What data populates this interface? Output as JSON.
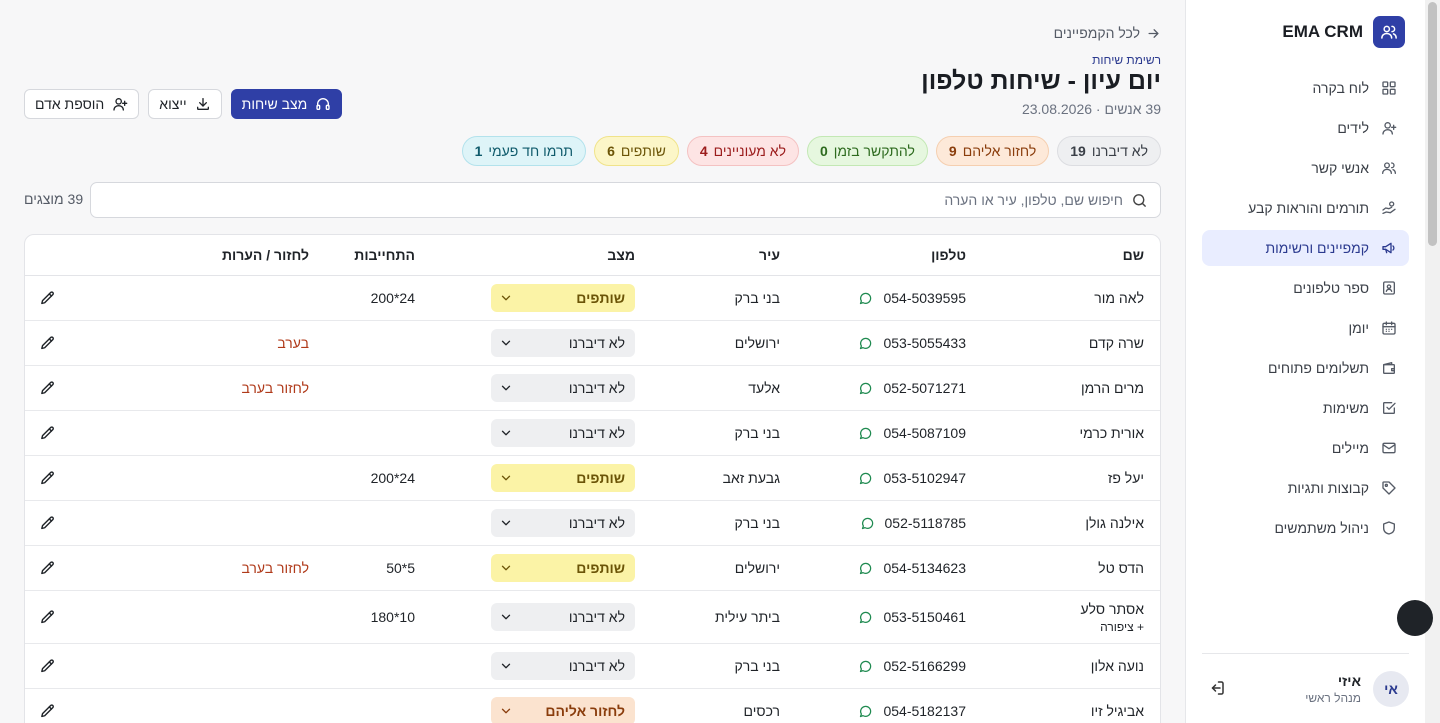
{
  "brand": {
    "name": "EMA CRM"
  },
  "nav": [
    {
      "id": "dashboard",
      "label": "לוח בקרה",
      "icon": "dashboard-icon"
    },
    {
      "id": "leads",
      "label": "לידים",
      "icon": "user-plus-icon"
    },
    {
      "id": "contacts",
      "label": "אנשי קשר",
      "icon": "users-icon"
    },
    {
      "id": "donors",
      "label": "תורמים והוראות קבע",
      "icon": "hand-coins-icon"
    },
    {
      "id": "campaigns",
      "label": "קמפיינים ורשימות",
      "icon": "megaphone-icon",
      "active": true
    },
    {
      "id": "phonebook",
      "label": "ספר טלפונים",
      "icon": "contact-book-icon"
    },
    {
      "id": "calendar",
      "label": "יומן",
      "icon": "calendar-icon"
    },
    {
      "id": "payments",
      "label": "תשלומים פתוחים",
      "icon": "wallet-icon"
    },
    {
      "id": "tasks",
      "label": "משימות",
      "icon": "checkbox-icon"
    },
    {
      "id": "emails",
      "label": "מיילים",
      "icon": "mail-icon"
    },
    {
      "id": "groups",
      "label": "קבוצות ותגיות",
      "icon": "tag-icon"
    },
    {
      "id": "users",
      "label": "ניהול משתמשים",
      "icon": "shield-icon"
    }
  ],
  "user": {
    "initials": "אי",
    "name": "איזי",
    "role": "מנהל ראשי"
  },
  "header": {
    "back": "לכל הקמפיינים",
    "section": "רשימת שיחות",
    "title": "יום עיון - שיחות טלפון",
    "subtitle": "39 אנשים · 23.08.2026"
  },
  "actions": {
    "call_mode": "מצב שיחות",
    "export": "ייצוא",
    "add_person": "הוספת אדם"
  },
  "chips": [
    {
      "label": "לא דיברנו",
      "count": "19",
      "bg": "#eeeff1",
      "border": "#dcdde1",
      "color": "#3a3f47"
    },
    {
      "label": "לחזור אליהם",
      "count": "9",
      "bg": "#fde9d9",
      "border": "#f5cfb0",
      "color": "#8a3d0c"
    },
    {
      "label": "להתקשר בזמן",
      "count": "0",
      "bg": "#e6f7df",
      "border": "#c3e8b4",
      "color": "#2e6b1f"
    },
    {
      "label": "לא מעוניינים",
      "count": "4",
      "bg": "#fde4e4",
      "border": "#f4c2c2",
      "color": "#9b1c1c"
    },
    {
      "label": "שותפים",
      "count": "6",
      "bg": "#fcf6c8",
      "border": "#f0e38a",
      "color": "#6b5407"
    },
    {
      "label": "תרמו חד פעמי",
      "count": "1",
      "bg": "#def4f8",
      "border": "#b3e2ec",
      "color": "#0f5a6b"
    }
  ],
  "search": {
    "placeholder": "חיפוש שם, טלפון, עיר או הערה"
  },
  "count": "39 מוצגים",
  "table": {
    "headers": {
      "name": "שם",
      "phone": "טלפון",
      "city": "עיר",
      "status": "מצב",
      "commit": "התחייבות",
      "notes": "לחזור / הערות"
    },
    "rows": [
      {
        "name": "לאה מור",
        "phone": "054-5039595",
        "city": "בני ברק",
        "status": "שותפים",
        "status_type": "partner",
        "commit": "200*24",
        "notes": ""
      },
      {
        "name": "שרה קדם",
        "phone": "053-5055433",
        "city": "ירושלים",
        "status": "לא דיברנו",
        "status_type": "none",
        "commit": "",
        "notes": "בערב"
      },
      {
        "name": "מרים הרמן",
        "phone": "052-5071271",
        "city": "אלעד",
        "status": "לא דיברנו",
        "status_type": "none",
        "commit": "",
        "notes": "לחזור בערב"
      },
      {
        "name": "אורית כרמי",
        "phone": "054-5087109",
        "city": "בני ברק",
        "status": "לא דיברנו",
        "status_type": "none",
        "commit": "",
        "notes": ""
      },
      {
        "name": "יעל פז",
        "phone": "053-5102947",
        "city": "גבעת זאב",
        "status": "שותפים",
        "status_type": "partner",
        "commit": "200*24",
        "notes": ""
      },
      {
        "name": "אילנה גולן",
        "phone": "052-5118785",
        "city": "בני ברק",
        "status": "לא דיברנו",
        "status_type": "none",
        "commit": "",
        "notes": ""
      },
      {
        "name": "הדס טל",
        "phone": "054-5134623",
        "city": "ירושלים",
        "status": "שותפים",
        "status_type": "partner",
        "commit": "50*5",
        "notes": "לחזור בערב"
      },
      {
        "name": "אסתר סלע",
        "sub": "+ ציפורה",
        "phone": "053-5150461",
        "city": "ביתר עילית",
        "status": "לא דיברנו",
        "status_type": "none",
        "commit": "180*10",
        "notes": ""
      },
      {
        "name": "נועה אלון",
        "phone": "052-5166299",
        "city": "בני ברק",
        "status": "לא דיברנו",
        "status_type": "none",
        "commit": "",
        "notes": ""
      },
      {
        "name": "אביגיל זיו",
        "phone": "054-5182137",
        "city": "רכסים",
        "status": "לחזור אליהם",
        "status_type": "callback",
        "commit": "",
        "notes": ""
      }
    ]
  }
}
